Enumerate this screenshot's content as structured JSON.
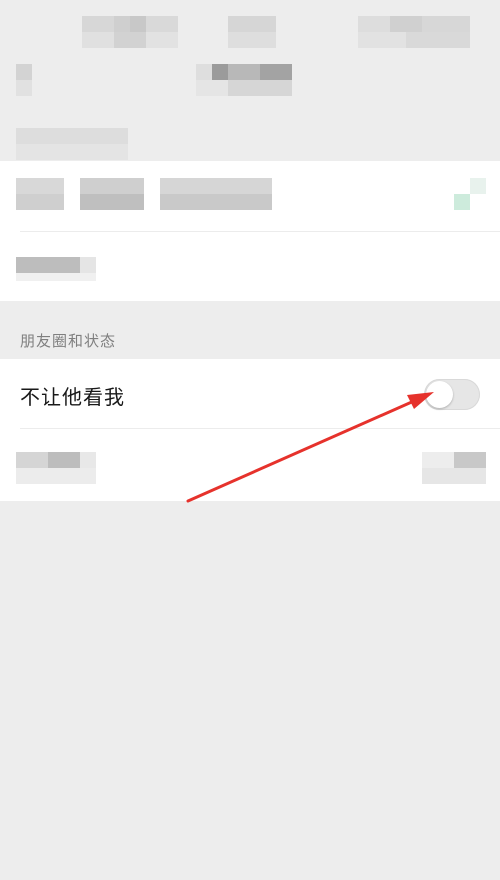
{
  "section": {
    "title": "朋友圈和状态"
  },
  "privacy_row": {
    "label": "不让他看我",
    "toggle_state": "off"
  },
  "colors": {
    "page_background": "#ededed",
    "card_background": "#ffffff",
    "annotation_arrow": "#e6322c"
  }
}
